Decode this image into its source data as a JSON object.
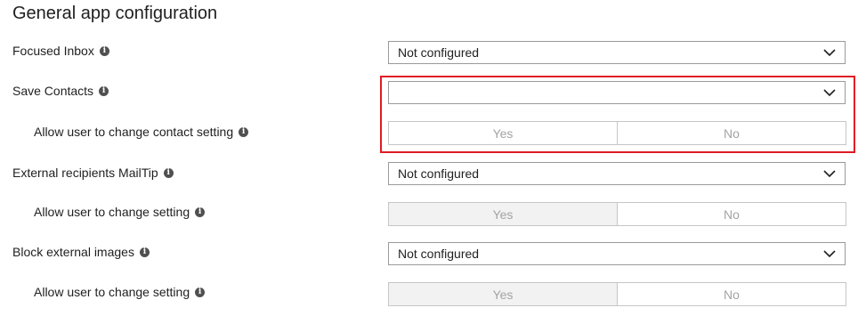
{
  "page": {
    "title": "General app configuration"
  },
  "settings": {
    "focused_inbox": {
      "label": "Focused Inbox",
      "value": "Not configured"
    },
    "save_contacts": {
      "label": "Save Contacts",
      "value": ""
    },
    "allow_contact_setting": {
      "label": "Allow user to change contact setting",
      "yes": "Yes",
      "no": "No"
    },
    "external_mailtip": {
      "label": "External recipients MailTip",
      "value": "Not configured"
    },
    "allow_mailtip_setting": {
      "label": "Allow user to change setting",
      "yes": "Yes",
      "no": "No"
    },
    "block_external_images": {
      "label": "Block external images",
      "value": "Not configured"
    },
    "allow_images_setting": {
      "label": "Allow user to change setting",
      "yes": "Yes",
      "no": "No"
    }
  },
  "icons": {
    "info": "info-icon",
    "chevron": "chevron-down-icon"
  },
  "colors": {
    "highlight": "#e01b24",
    "disabled_text": "#a3a3a3",
    "selected_bg": "#f2f2f2"
  }
}
